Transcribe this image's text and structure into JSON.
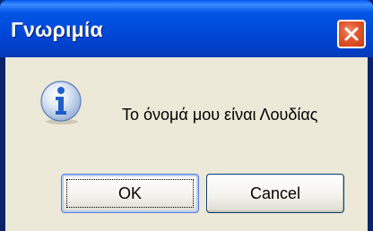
{
  "window": {
    "title": "Γνωριμία",
    "message": "Το όνομά μου είναι Λουδίας",
    "message_icon": "information-icon",
    "close_icon": "close-icon"
  },
  "buttons": {
    "ok_label": "OK",
    "cancel_label": "Cancel"
  },
  "colors": {
    "titlebar": "#0054e3",
    "client_background": "#ece9d8",
    "close_button": "#e2582f",
    "info_icon": "#1f5ec9"
  }
}
